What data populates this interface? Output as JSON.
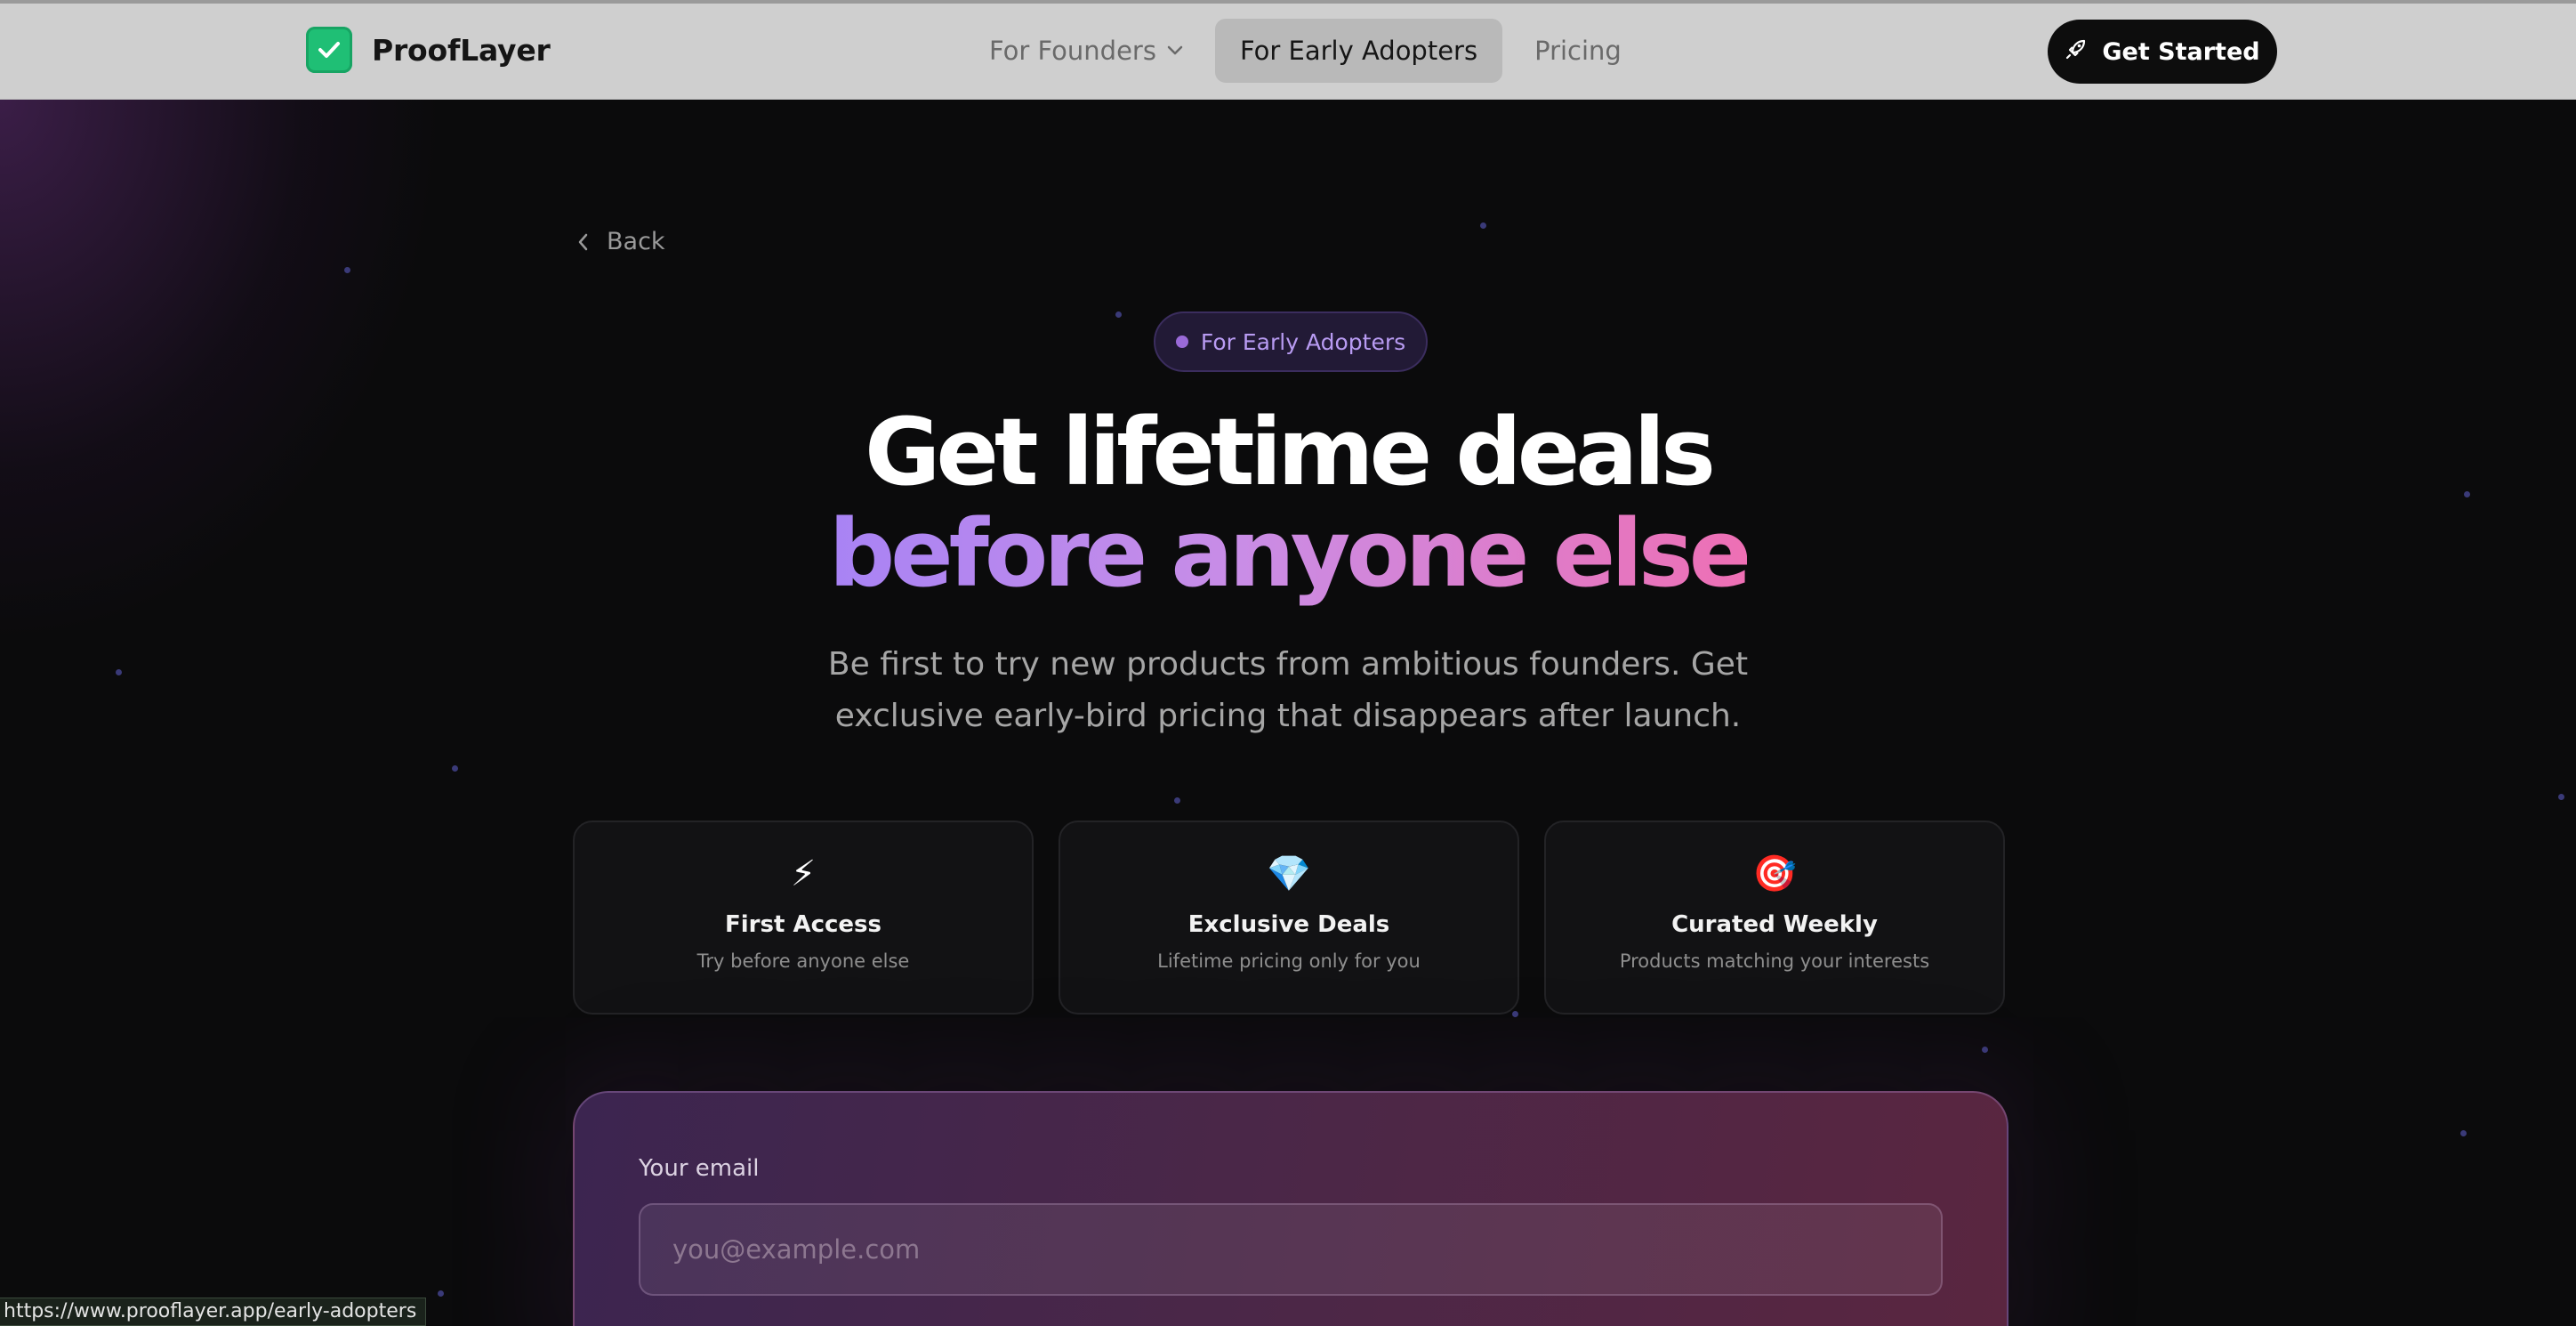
{
  "nav": {
    "brand": "ProofLayer",
    "links": [
      {
        "label": "For Founders"
      },
      {
        "label": "For Early Adopters"
      },
      {
        "label": "Pricing"
      }
    ],
    "cta_label": "Get Started"
  },
  "hero": {
    "back_label": "Back",
    "pill_label": "For Early Adopters",
    "title_line1": "Get lifetime deals",
    "title_line2": "before anyone else",
    "subtitle": "Be first to try new products from ambitious founders. Get exclusive early-bird pricing that disappears after launch."
  },
  "features": [
    {
      "icon": "⚡",
      "icon_name": "lightning-icon",
      "title": "First Access",
      "desc": "Try before anyone else"
    },
    {
      "icon": "💎",
      "icon_name": "gem-icon",
      "title": "Exclusive Deals",
      "desc": "Lifetime pricing only for you"
    },
    {
      "icon": "🎯",
      "icon_name": "target-icon",
      "title": "Curated Weekly",
      "desc": "Products matching your interests"
    }
  ],
  "signup": {
    "email_label": "Your email",
    "email_placeholder": "you@example.com",
    "email_value": ""
  },
  "status_bar": {
    "url": "https://www.prooflayer.app/early-adopters"
  },
  "colors": {
    "brand_green": "#1fbf75",
    "accent_purple": "#a883f5",
    "accent_pink": "#ee6fb4",
    "nav_bg": "#cfcfcf",
    "page_bg": "#0b0b0c"
  }
}
